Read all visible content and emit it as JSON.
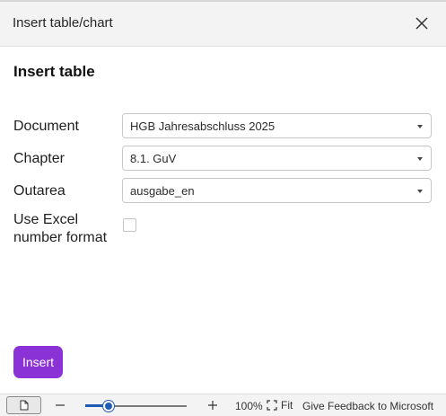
{
  "dialog": {
    "title": "Insert table/chart",
    "heading": "Insert table"
  },
  "form": {
    "document": {
      "label": "Document",
      "value": "HGB Jahresabschluss 2025"
    },
    "chapter": {
      "label": "Chapter",
      "value": "8.1. GuV"
    },
    "outarea": {
      "label": "Outarea",
      "value": "ausgabe_en"
    },
    "excel_format": {
      "label_line1": "Use Excel",
      "label_line2": "number format",
      "checked": false
    },
    "insert_label": "Insert"
  },
  "statusbar": {
    "zoom_percent": "100%",
    "zoom_level": 0.23,
    "fit_label": "Fit",
    "feedback_label": "Give Feedback to Microsoft"
  },
  "colors": {
    "accent": "#8a32d6",
    "slider": "#1f5bb5"
  },
  "icons": {
    "close": "close-icon",
    "page": "page-icon",
    "fit": "fit-icon",
    "dropdown": "chevron-down-icon"
  }
}
